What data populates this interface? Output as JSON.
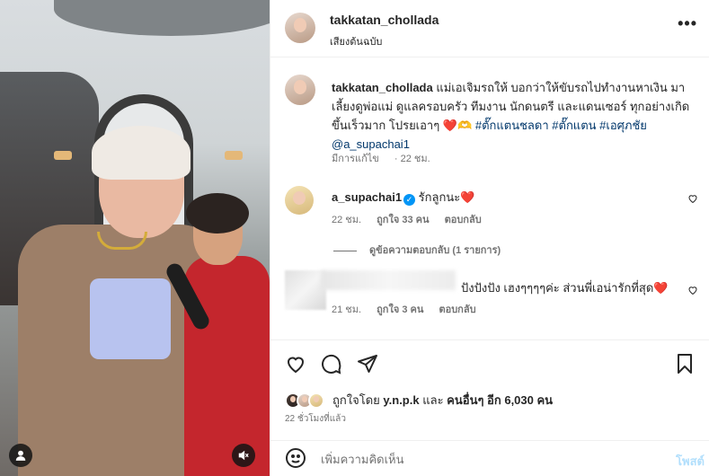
{
  "header": {
    "username": "takkatan_chollada",
    "audio": "เสียงต้นฉบับ",
    "more_icon": "•••"
  },
  "caption": {
    "username": "takkatan_chollada",
    "text": "แม่เอเจิมรถให้ บอกว่าให้ขับรถไปทำงานหาเงิน มาเลี้ยงดูพ่อแม่ ดูแลครอบครัว ทีมงาน นักดนตรี และแดนเซอร์ ทุกอย่างเกิดขึ้นเร็วมาก โปรยเอาๆ",
    "emojis": "❤️🫶",
    "hashtags": [
      "#ตั๊กแตนชลดา",
      "#ตั๊กแตน",
      "#เอศุภชัย"
    ],
    "mention": "@a_supachai1",
    "edited": "มีการแก้ไข",
    "time": "22 ชม."
  },
  "comments": [
    {
      "username": "a_supachai1",
      "verified": true,
      "text": "รักลูกนะ",
      "emoji": "❤️",
      "time": "22 ชม.",
      "likes": "ถูกใจ 33 คน",
      "reply": "ตอบกลับ",
      "view_replies": "ดูข้อความตอบกลับ (1 รายการ)"
    },
    {
      "username": "",
      "text": "ปังปังปัง เฮงๆๆๆๆค่ะ ส่วนพี่เอน่ารักที่สุด",
      "emoji": "❤️",
      "time": "21 ชม.",
      "likes": "ถูกใจ 3 คน",
      "reply": "ตอบกลับ"
    }
  ],
  "actions": {
    "liked_by_prefix": "ถูกใจโดย",
    "liked_by_user": "y.n.p.k",
    "liked_by_and": "และ",
    "liked_by_others": "คนอื่นๆ อีก 6,030 คน",
    "posted_ago": "22 ชั่วโมงที่แล้ว"
  },
  "comment_box": {
    "placeholder": "เพิ่มความคิดเห็น",
    "post_label": "โพสต์"
  },
  "colors": {
    "link": "#00376b",
    "verified": "#0095f6",
    "heart": "#ed4956",
    "post_disabled": "#b2dffc"
  },
  "icons": [
    "heart-icon",
    "comment-icon",
    "share-icon",
    "save-icon",
    "emoji-icon",
    "mute-icon",
    "user-tag-icon",
    "more-icon",
    "verified-icon"
  ]
}
